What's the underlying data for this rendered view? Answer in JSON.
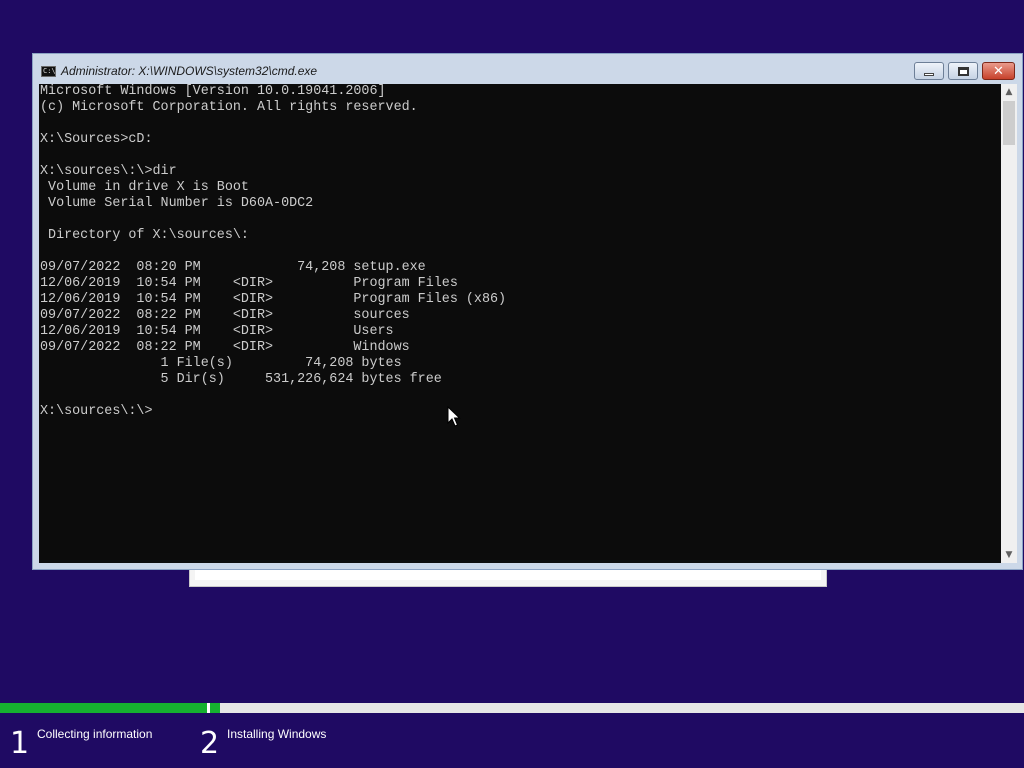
{
  "window": {
    "title": "Administrator: X:\\WINDOWS\\system32\\cmd.exe",
    "icon": "cmd-icon",
    "icon_text": "C:\\"
  },
  "console": {
    "lines": [
      "Microsoft Windows [Version 10.0.19041.2006]",
      "(c) Microsoft Corporation. All rights reserved.",
      "",
      "X:\\Sources>cD:",
      "",
      "X:\\sources\\:\\>dir",
      " Volume in drive X is Boot",
      " Volume Serial Number is D60A-0DC2",
      "",
      " Directory of X:\\sources\\:",
      "",
      "09/07/2022  08:20 PM            74,208 setup.exe",
      "12/06/2019  10:54 PM    <DIR>          Program Files",
      "12/06/2019  10:54 PM    <DIR>          Program Files (x86)",
      "09/07/2022  08:22 PM    <DIR>          sources",
      "12/06/2019  10:54 PM    <DIR>          Users",
      "09/07/2022  08:22 PM    <DIR>          Windows",
      "               1 File(s)         74,208 bytes",
      "               5 Dir(s)     531,226,624 bytes free",
      "",
      "X:\\sources\\:\\>"
    ]
  },
  "setup_progress": {
    "steps": [
      {
        "number": "1",
        "label": "Collecting information",
        "progress": 1.0
      },
      {
        "number": "2",
        "label": "Installing Windows",
        "progress": 0.012
      }
    ]
  },
  "colors": {
    "desktop_background": "#1f0a63",
    "progress_fill": "#16b030",
    "console_background": "#0c0c0c",
    "console_text": "#cccccc"
  }
}
